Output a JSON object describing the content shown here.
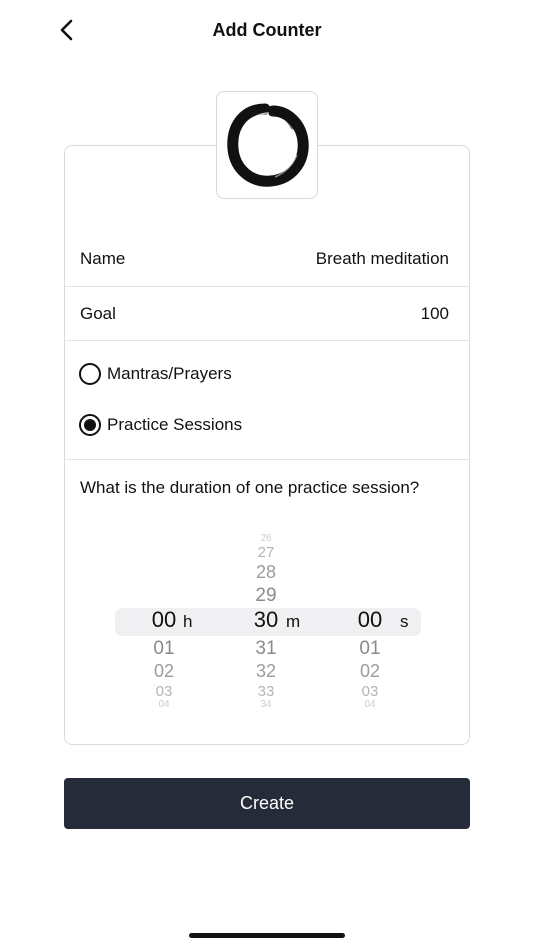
{
  "header": {
    "title": "Add Counter",
    "back_icon": "chevron-left-icon"
  },
  "avatar": {
    "icon": "enso-circle-icon"
  },
  "form": {
    "name_label": "Name",
    "name_value": "Breath meditation",
    "goal_label": "Goal",
    "goal_value": "100",
    "options": [
      {
        "label": "Mantras/Prayers",
        "selected": false
      },
      {
        "label": "Practice Sessions",
        "selected": true
      }
    ],
    "question": "What is the duration of one practice session?"
  },
  "picker": {
    "hours": {
      "above": [],
      "selected": "00",
      "below": [
        "01",
        "02",
        "03",
        "04"
      ],
      "unit": "h"
    },
    "minutes": {
      "above": [
        "26",
        "27",
        "28",
        "29"
      ],
      "selected": "30",
      "below": [
        "31",
        "32",
        "33",
        "34"
      ],
      "unit": "m"
    },
    "seconds": {
      "above": [],
      "selected": "00",
      "below": [
        "01",
        "02",
        "03",
        "04"
      ],
      "unit": "s"
    }
  },
  "actions": {
    "create_label": "Create"
  },
  "colors": {
    "button_bg": "#262b3a",
    "button_text": "#ffffff",
    "card_border": "#dadade"
  }
}
